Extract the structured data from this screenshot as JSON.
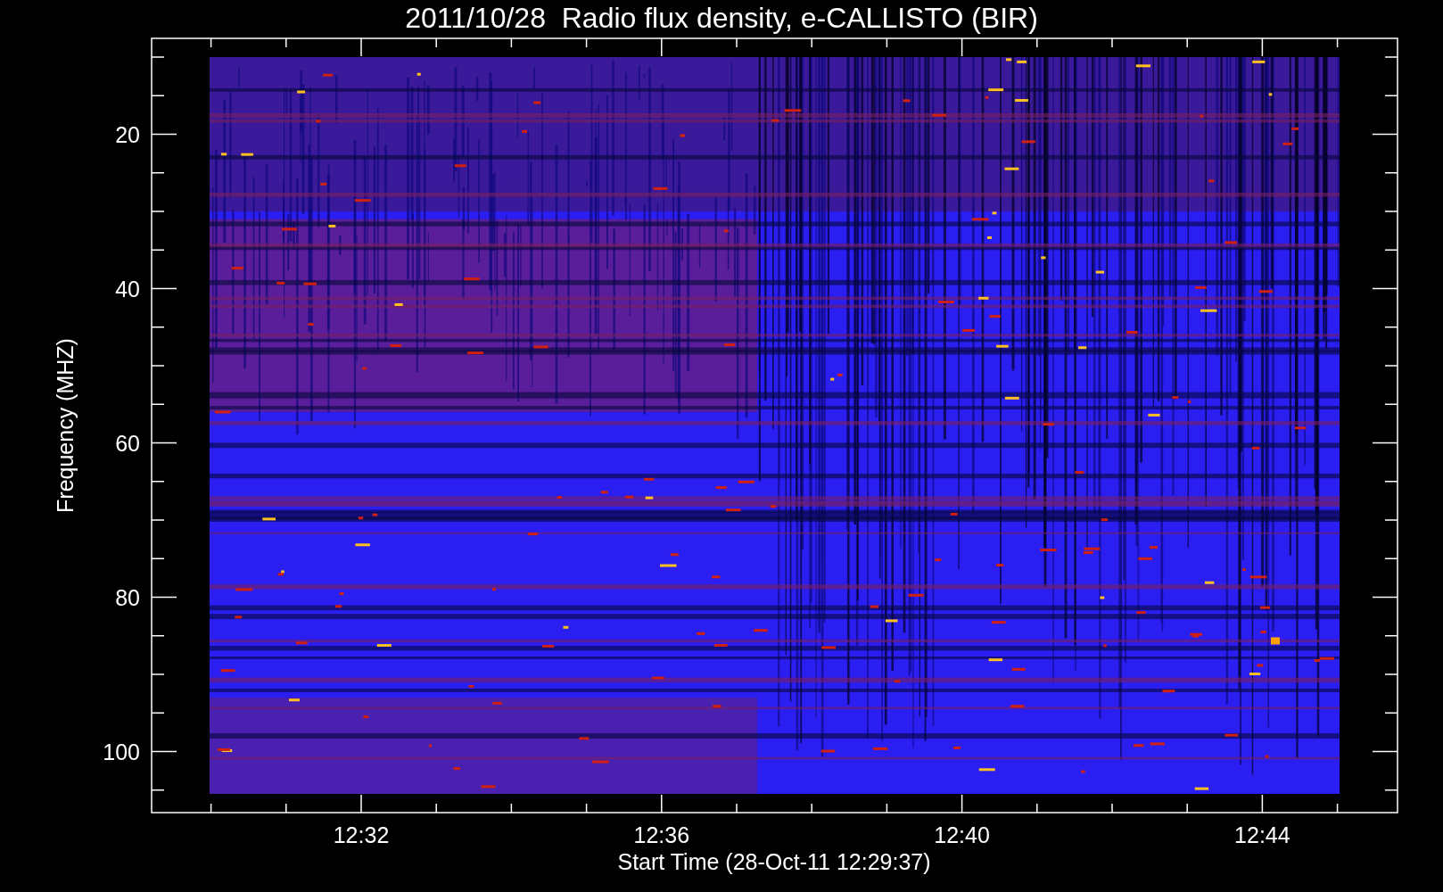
{
  "title": "2011/10/28  Radio flux density, e-CALLISTO (BIR)",
  "ylabel": "Frequency (MHZ)",
  "xlabel": "Start Time (28-Oct-11 12:29:37)",
  "yticks": [
    "20",
    "40",
    "60",
    "80",
    "100"
  ],
  "xticks": [
    "12:32",
    "12:36",
    "12:40",
    "12:44"
  ]
}
